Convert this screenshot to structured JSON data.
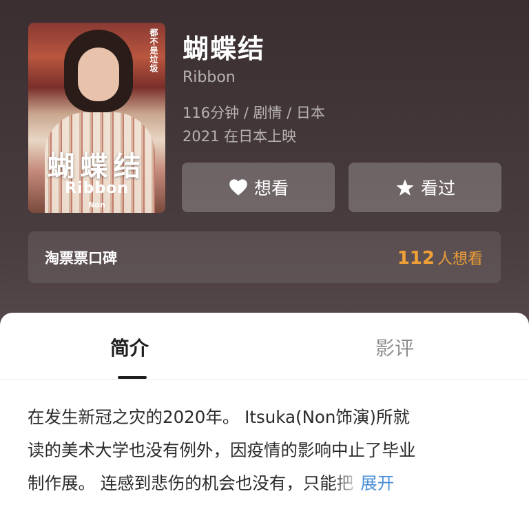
{
  "movie": {
    "title": "蝴蝶结",
    "original_title": "Ribbon",
    "duration_genre_region": "116分钟 / 剧情 / 日本",
    "release": "2021 在日本上映"
  },
  "poster": {
    "title": "蝴蝶结",
    "subtitle": "Ribbon",
    "vertical_text": "都不是垃圾",
    "cast": "Non"
  },
  "actions": {
    "want_label": "想看",
    "want_icon": "heart-icon",
    "seen_label": "看过",
    "seen_icon": "star-icon"
  },
  "rating": {
    "label": "淘票票口碑",
    "count": "112",
    "count_unit": "人想看",
    "accent_color": "#f0a037"
  },
  "tabs": {
    "intro": "简介",
    "review": "影评",
    "active": "简介"
  },
  "synopsis": {
    "line1": "在发生新冠之灾的2020年。 Itsuka(Non饰演)所就",
    "line2": "读的美术大学也没有例外，因疫情的影响中止了毕业",
    "line3": "制作展。 连感到悲伤的机会也没有，只能把",
    "expand": "展开"
  }
}
